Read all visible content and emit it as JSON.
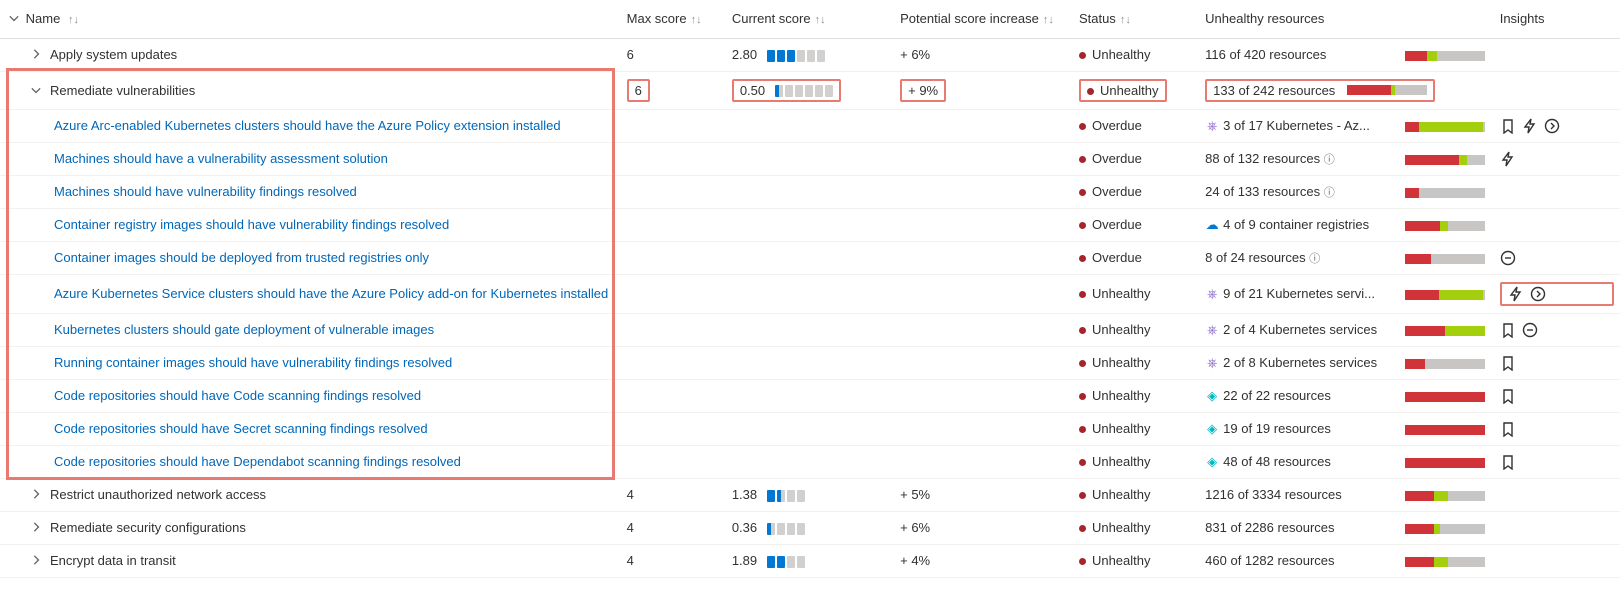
{
  "columns": {
    "name": "Name",
    "max_score": "Max score",
    "current_score": "Current score",
    "potential": "Potential score increase",
    "status": "Status",
    "unhealthy": "Unhealthy resources",
    "insights": "Insights"
  },
  "status_labels": {
    "unhealthy": "Unhealthy",
    "overdue": "Overdue"
  },
  "groups": [
    {
      "id": "g0",
      "name": "Apply system updates",
      "expanded": false,
      "max_score": "6",
      "current_score": "2.80",
      "score_segments": 6,
      "score_fill": 3,
      "score_half": false,
      "potential": "+ 6%",
      "status": "unhealthy",
      "resources_text": "116 of 420 resources",
      "bar": {
        "red": 28,
        "lime": 12,
        "grey": 60
      },
      "highlight": false
    },
    {
      "id": "g1",
      "name": "Remediate vulnerabilities",
      "expanded": true,
      "max_score": "6",
      "current_score": "0.50",
      "score_segments": 6,
      "score_fill": 0,
      "score_half": true,
      "potential": "+ 9%",
      "status": "unhealthy",
      "resources_text": "133 of 242 resources",
      "bar": {
        "red": 55,
        "lime": 5,
        "grey": 40
      },
      "highlight": true,
      "children": [
        {
          "name": "Azure Arc-enabled Kubernetes clusters should have the Azure Policy extension installed",
          "status": "overdue",
          "res_icon": "k8s",
          "resources_text": "3 of 17 Kubernetes - Az...",
          "bar": {
            "red": 18,
            "lime": 80,
            "grey": 2
          },
          "insights": [
            "bookmark",
            "flash",
            "circle-right"
          ]
        },
        {
          "name": "Machines should have a vulnerability assessment solution",
          "status": "overdue",
          "resources_text": "88 of 132 resources",
          "info": true,
          "bar": {
            "red": 67,
            "lime": 10,
            "grey": 23
          },
          "insights": [
            "flash"
          ]
        },
        {
          "name": "Machines should have vulnerability findings resolved",
          "status": "overdue",
          "resources_text": "24 of 133 resources",
          "info": true,
          "bar": {
            "red": 18,
            "lime": 0,
            "grey": 82
          },
          "insights": []
        },
        {
          "name": "Container registry images should have vulnerability findings resolved",
          "status": "overdue",
          "res_icon": "cloud",
          "resources_text": "4 of 9 container registries",
          "bar": {
            "red": 44,
            "lime": 10,
            "grey": 46
          },
          "insights": []
        },
        {
          "name": "Container images should be deployed from trusted registries only",
          "status": "overdue",
          "resources_text": "8 of 24 resources",
          "info": true,
          "bar": {
            "red": 33,
            "lime": 0,
            "grey": 67
          },
          "insights": [
            "circle-minus"
          ]
        },
        {
          "name": "Azure Kubernetes Service clusters should have the Azure Policy add-on for Kubernetes installed",
          "status": "unhealthy",
          "res_icon": "k8s",
          "resources_text": "9 of 21 Kubernetes servi...",
          "bar": {
            "red": 43,
            "lime": 55,
            "grey": 2
          },
          "insights": [
            "flash",
            "circle-right"
          ],
          "insights_highlight": true
        },
        {
          "name": "Kubernetes clusters should gate deployment of vulnerable images",
          "status": "unhealthy",
          "res_icon": "k8s",
          "resources_text": "2 of 4 Kubernetes services",
          "bar": {
            "red": 50,
            "lime": 50,
            "grey": 0
          },
          "insights": [
            "bookmark",
            "circle-minus"
          ]
        },
        {
          "name": "Running container images should have vulnerability findings resolved",
          "status": "unhealthy",
          "res_icon": "k8s",
          "resources_text": "2 of 8 Kubernetes services",
          "bar": {
            "red": 25,
            "lime": 0,
            "grey": 75
          },
          "insights": [
            "bookmark"
          ]
        },
        {
          "name": "Code repositories should have Code scanning findings resolved",
          "status": "unhealthy",
          "res_icon": "repo",
          "resources_text": "22 of 22 resources",
          "bar": {
            "red": 100,
            "lime": 0,
            "grey": 0
          },
          "insights": [
            "bookmark"
          ]
        },
        {
          "name": "Code repositories should have Secret scanning findings resolved",
          "status": "unhealthy",
          "res_icon": "repo",
          "resources_text": "19 of 19 resources",
          "bar": {
            "red": 100,
            "lime": 0,
            "grey": 0
          },
          "insights": [
            "bookmark"
          ]
        },
        {
          "name": "Code repositories should have Dependabot scanning findings resolved",
          "status": "unhealthy",
          "res_icon": "repo",
          "resources_text": "48 of 48 resources",
          "bar": {
            "red": 100,
            "lime": 0,
            "grey": 0
          },
          "insights": [
            "bookmark"
          ]
        }
      ]
    },
    {
      "id": "g2",
      "name": "Restrict unauthorized network access",
      "expanded": false,
      "max_score": "4",
      "current_score": "1.38",
      "score_segments": 4,
      "score_fill": 1,
      "score_half": true,
      "potential": "+ 5%",
      "status": "unhealthy",
      "resources_text": "1216 of 3334 resources",
      "bar": {
        "red": 36,
        "lime": 18,
        "grey": 46
      }
    },
    {
      "id": "g3",
      "name": "Remediate security configurations",
      "expanded": false,
      "max_score": "4",
      "current_score": "0.36",
      "score_segments": 4,
      "score_fill": 0,
      "score_half": true,
      "potential": "+ 6%",
      "status": "unhealthy",
      "resources_text": "831 of 2286 resources",
      "bar": {
        "red": 36,
        "lime": 8,
        "grey": 56
      }
    },
    {
      "id": "g4",
      "name": "Encrypt data in transit",
      "expanded": false,
      "max_score": "4",
      "current_score": "1.89",
      "score_segments": 4,
      "score_fill": 2,
      "score_half": false,
      "potential": "+ 4%",
      "status": "unhealthy",
      "resources_text": "460 of 1282 resources",
      "bar": {
        "red": 36,
        "lime": 18,
        "grey": 46
      }
    }
  ]
}
